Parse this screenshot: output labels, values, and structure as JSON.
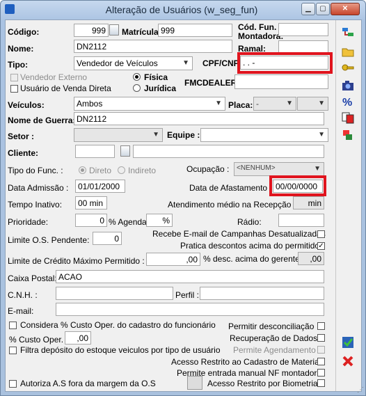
{
  "window": {
    "title": "Alteração de Usuários (w_seg_fun)"
  },
  "fields": {
    "codigo": {
      "label": "Código:",
      "value": "999"
    },
    "matricula": {
      "label": "Matrícula:",
      "value": "999"
    },
    "cod_fun_montadora": {
      "label": "Cód. Fun. Montadora:",
      "value": ""
    },
    "nome": {
      "label": "Nome:",
      "value": "DN2112"
    },
    "ramal": {
      "label": "Ramal:",
      "value": ""
    },
    "tipo": {
      "label": "Tipo:",
      "value": "Vendedor de Veículos"
    },
    "cpf_cnpj": {
      "label": "CPF/CNPJ",
      "value": " .  .   -"
    },
    "vendedor_externo": {
      "label": "Vendedor Externo"
    },
    "usuario_venda_direta": {
      "label": "Usuário de Venda Direta"
    },
    "fisica": {
      "label": "Física"
    },
    "juridica": {
      "label": "Jurídica"
    },
    "fmcdealer": {
      "label": "FMCDEALER:",
      "value": ""
    },
    "veiculos": {
      "label": "Veículos:",
      "value": "Ambos"
    },
    "placa": {
      "label": "Placa:",
      "value": "-"
    },
    "nome_guerra": {
      "label": "Nome de Guerra:",
      "value": "DN2112"
    },
    "setor": {
      "label": "Setor :",
      "value": ""
    },
    "equipe": {
      "label": "Equipe :",
      "value": ""
    },
    "cliente": {
      "label": "Cliente:",
      "value": ""
    },
    "tipo_func": {
      "label": "Tipo do Func. :"
    },
    "direto": {
      "label": "Direto"
    },
    "indireto": {
      "label": "Indireto"
    },
    "ocupacao": {
      "label": "Ocupação :",
      "value": "<NENHUM>"
    },
    "data_admissao": {
      "label": "Data Admissão :",
      "value": "01/01/2000"
    },
    "data_afastamento": {
      "label": "Data de Afastamento :",
      "value": "00/00/0000"
    },
    "tempo_inativo": {
      "label": "Tempo Inativo:",
      "value": "00 min"
    },
    "atendimento_medio": {
      "label": "Atendimento médio na Recepção :",
      "value": "min"
    },
    "prioridade": {
      "label": "Prioridade:",
      "value": "0"
    },
    "pct_agenda": {
      "label": "% Agenda:",
      "value": "%"
    },
    "radio": {
      "label": "Rádio:",
      "value": ""
    },
    "limite_os": {
      "label": "Limite O.S. Pendente:",
      "value": "0"
    },
    "recebe_email": {
      "label": "Recebe E-mail de Campanhas Desatualizadas"
    },
    "pratica_descontos": {
      "label": "Pratica descontos acima do permitido"
    },
    "limite_credito": {
      "label": "Limite de Crédito Máximo Permitido :",
      "value": ",00"
    },
    "pct_desc_gerente": {
      "label": "% desc. acima do gerente:",
      "value": ",00"
    },
    "caixa_postal": {
      "label": "Caixa Postal:",
      "value": "ACAO"
    },
    "cnh": {
      "label": "C.N.H. :",
      "value": ""
    },
    "perfil": {
      "label": "Perfil :",
      "value": ""
    },
    "email": {
      "label": "E-mail:",
      "value": ""
    },
    "considera_custo": {
      "label": "Considera % Custo Oper. do cadastro do funcionário"
    },
    "pct_custo_oper": {
      "label": "% Custo Oper.",
      "value": ",00"
    },
    "filtra_deposito": {
      "label": "Filtra depósito do estoque veiculos por tipo de usuário"
    },
    "autoriza_as": {
      "label": "Autoriza A.S fora da margem da O.S"
    },
    "permitir_desconciliacao": {
      "label": "Permitir desconciliação"
    },
    "recuperacao_dados": {
      "label": "Recuperação de Dados"
    },
    "permite_agendamento": {
      "label": "Permite Agendamento"
    },
    "acesso_restrito_material": {
      "label": "Acesso Restrito ao Cadastro de Material"
    },
    "permite_entrada_nf": {
      "label": "Permite entrada manual NF montadora"
    },
    "acesso_restrito_biometria": {
      "label": "Acesso Restrito por Biometria"
    }
  }
}
